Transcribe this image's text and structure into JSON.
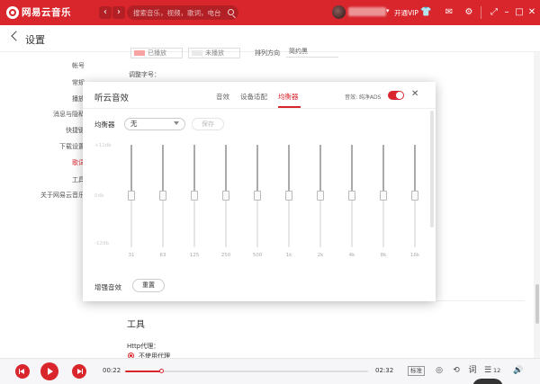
{
  "app": {
    "name": "网易云音乐"
  },
  "search": {
    "placeholder": "搜索音乐，视频，歌词，电台"
  },
  "titlebar": {
    "vip_label": "开通VIP"
  },
  "settings": {
    "title": "设置",
    "nav": [
      "帐号",
      "常规",
      "播放",
      "消息与隐私",
      "快捷键",
      "下载设置",
      "歌词",
      "工具",
      "关于网易云音乐"
    ],
    "active_nav": "歌词"
  },
  "background": {
    "chip_played": "已播放",
    "chip_unplayed": "未播放",
    "align_label": "排列方向",
    "align_value": "简约黑",
    "font_label": "调整字号：",
    "tools_title": "工具",
    "proxy_label": "Http代理：",
    "proxy_value": "不使用代理"
  },
  "dialog": {
    "title": "听云音效",
    "tabs": [
      "音效",
      "设备适配",
      "均衡器"
    ],
    "active_tab": "均衡器",
    "sound_label": "音效: 纯净ADS",
    "sound_enabled": true,
    "eq": {
      "label": "均衡器",
      "preset": "无",
      "save_label": "保存",
      "db_labels": [
        "+12db",
        "0db",
        "-12db"
      ],
      "bands": [
        {
          "freq": "31",
          "gain": 0
        },
        {
          "freq": "63",
          "gain": 0
        },
        {
          "freq": "125",
          "gain": 0
        },
        {
          "freq": "250",
          "gain": 0
        },
        {
          "freq": "500",
          "gain": 0
        },
        {
          "freq": "1k",
          "gain": 0
        },
        {
          "freq": "2k",
          "gain": 0
        },
        {
          "freq": "4k",
          "gain": 0
        },
        {
          "freq": "8k",
          "gain": 0
        },
        {
          "freq": "16k",
          "gain": 0
        }
      ]
    },
    "enhance_label": "增强音效",
    "reset_label": "重置"
  },
  "player": {
    "current_time": "00:22",
    "total_time": "02:32",
    "progress": 0.15,
    "speed_label": "标准",
    "playlist_count": "12"
  },
  "colors": {
    "brand": "#d9262d"
  }
}
